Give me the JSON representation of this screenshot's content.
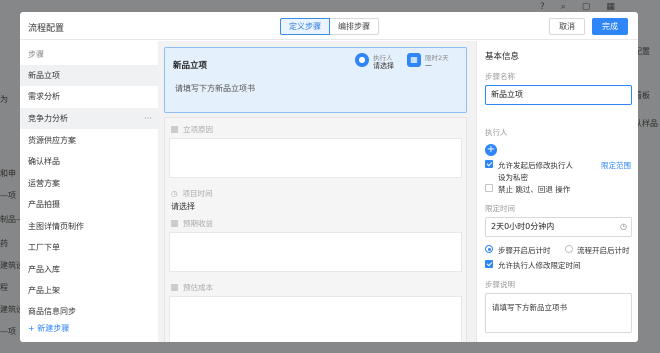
{
  "background": {
    "left_fragments": [
      "为",
      "和申",
      "—项",
      "制品—",
      "药",
      "建筑设",
      "程",
      "建筑设",
      "—项"
    ],
    "right_fragments": [
      "配置",
      "看板",
      "认样品"
    ]
  },
  "modal": {
    "title": "流程配置",
    "tabs": [
      {
        "label": "定义步骤",
        "active": true
      },
      {
        "label": "编排步骤",
        "active": false
      }
    ],
    "cancel_label": "取消",
    "done_label": "完成"
  },
  "steps": {
    "heading": "步骤",
    "items": [
      {
        "label": "新品立项",
        "selected": true
      },
      {
        "label": "需求分析",
        "selected": false
      },
      {
        "label": "竞争力分析",
        "selected": true,
        "more": "···"
      },
      {
        "label": "货源供应方案",
        "selected": false
      },
      {
        "label": "确认样品",
        "selected": false
      },
      {
        "label": "运营方案",
        "selected": false
      },
      {
        "label": "产品拍摄",
        "selected": false
      },
      {
        "label": "主图详情页制作",
        "selected": false
      },
      {
        "label": "工厂下单",
        "selected": false
      },
      {
        "label": "产品入库",
        "selected": false
      },
      {
        "label": "产品上架",
        "selected": false
      },
      {
        "label": "商品信息同步",
        "selected": false
      }
    ],
    "new_step": "+ 新建步骤"
  },
  "preview": {
    "card": {
      "title": "新品立项",
      "description": "请填写下方新品立项书",
      "executor_label": "执行人",
      "executor_value": "请选择",
      "deadline_label": "限时2天",
      "deadline_value": "—"
    },
    "fields": [
      {
        "label": "立项原因",
        "icon": "text-field-icon"
      },
      {
        "label": "项目时间",
        "icon": "clock-icon",
        "value": "请选择"
      },
      {
        "label": "预期收益",
        "icon": "text-field-icon"
      },
      {
        "label": "预估成本",
        "icon": "text-field-icon"
      }
    ]
  },
  "panel": {
    "title": "基本信息",
    "step_name_label": "步骤名称",
    "step_name_value": "新品立项",
    "executor_label": "执行人",
    "allow_modify_executor": "允许发起后修改执行人",
    "set_private": "设为私密",
    "set_range_link": "限定范围",
    "forbid_skip": "禁止 跳过、回退 操作",
    "time_limit_label": "限定时间",
    "time_limit_value": "2天0小时0分钟内",
    "start_on_step_open": "步骤开启后计时",
    "start_on_flow_open": "流程开启后计时",
    "allow_modify_time": "允许执行人修改限定时间",
    "step_desc_label": "步骤说明",
    "step_desc_value": "请填写下方新品立项书"
  },
  "colors": {
    "accent": "#2f86f6",
    "card_bg": "#e4f0fc",
    "card_border": "#8cc0f2"
  }
}
